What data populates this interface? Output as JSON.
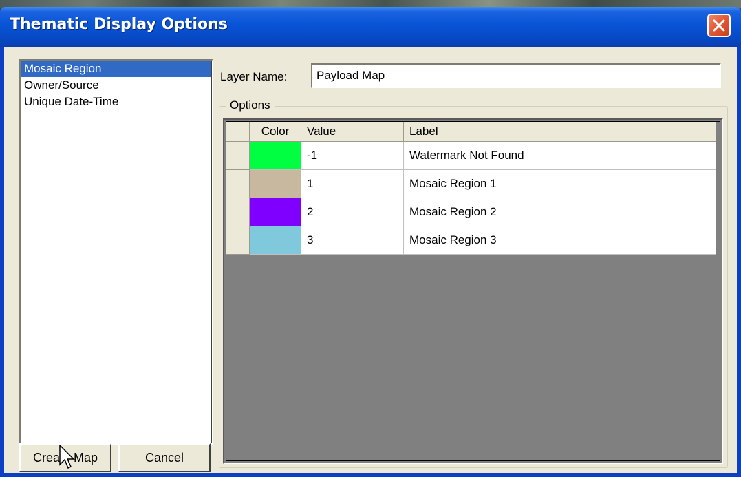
{
  "window": {
    "title": "Thematic Display Options"
  },
  "list": {
    "items": [
      {
        "label": "Mosaic Region",
        "selected": true
      },
      {
        "label": "Owner/Source",
        "selected": false
      },
      {
        "label": "Unique Date-Time",
        "selected": false
      }
    ]
  },
  "form": {
    "layer_name_label": "Layer Name:",
    "layer_name_value": "Payload Map",
    "options_label": "Options"
  },
  "grid": {
    "headers": {
      "color": "Color",
      "value": "Value",
      "label": "Label"
    },
    "rows": [
      {
        "color": "#00ff40",
        "value": "-1",
        "label": "Watermark Not Found"
      },
      {
        "color": "#c8b8a0",
        "value": "1",
        "label": "Mosaic Region 1"
      },
      {
        "color": "#8000ff",
        "value": "2",
        "label": "Mosaic Region 2"
      },
      {
        "color": "#80c8dc",
        "value": "3",
        "label": "Mosaic Region 3"
      }
    ]
  },
  "buttons": {
    "create_map": "Create Map",
    "cancel": "Cancel"
  },
  "colors": {
    "titlebar": "#0854d6",
    "selection": "#316ac5",
    "dialog_bg": "#ece9d8",
    "grid_empty": "#808080"
  }
}
